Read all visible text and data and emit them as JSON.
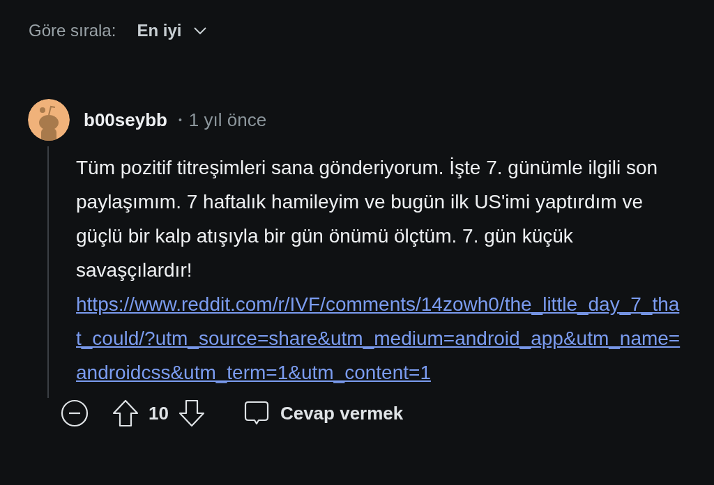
{
  "sort": {
    "label": "Göre sırala:",
    "value": "En iyi"
  },
  "comment": {
    "author": "b00seybb",
    "separator": "•",
    "time": "1 yıl önce",
    "body": "Tüm pozitif titreşimleri sana gönderiyorum. İşte 7. günümle ilgili son paylaşımım. 7 haftalık hamileyim ve bugün ilk US'imi yaptırdım ve güçlü bir kalp atışıyla bir gün önümü ölçtüm. 7. gün küçük savaşçılardır!",
    "link": "https://www.reddit.com/r/IVF/comments/14zowh0/the_little_day_7_that_could/?utm_source=share&utm_medium=android_app&utm_name=androidcss&utm_term=1&utm_content=1",
    "score": "10",
    "reply": "Cevap vermek"
  }
}
